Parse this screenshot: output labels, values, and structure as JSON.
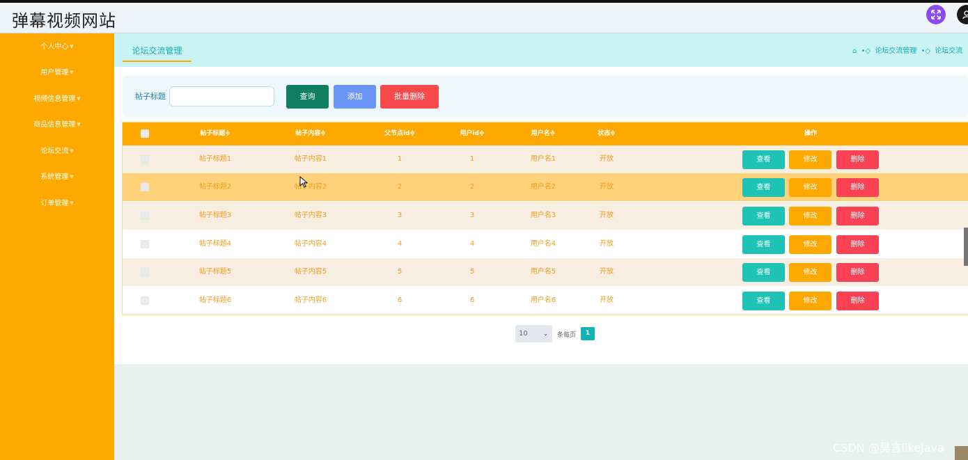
{
  "header": {
    "app_title": "弹幕视频网站",
    "expand_icon": "expand-icon",
    "user_icon": "user-icon"
  },
  "sidebar": {
    "items": [
      {
        "label": "个人中心",
        "icon": "caret-down-icon"
      },
      {
        "label": "用户管理",
        "icon": "caret-down-icon"
      },
      {
        "label": "视频信息管理",
        "icon": "caret-down-icon"
      },
      {
        "label": "商品信息管理",
        "icon": "caret-down-icon"
      },
      {
        "label": "论坛交流",
        "icon": "caret-down-icon"
      },
      {
        "label": "系统管理",
        "icon": "caret-down-icon"
      },
      {
        "label": "订单管理",
        "icon": "caret-down-icon"
      }
    ]
  },
  "tabs": {
    "active_label": "论坛交流管理"
  },
  "breadcrumb": {
    "home_icon": "home-icon",
    "items": [
      "论坛交流管理",
      "论坛交流"
    ]
  },
  "search": {
    "label": "帖子标题",
    "value": "",
    "placeholder": ""
  },
  "actions": {
    "query": "查询",
    "add": "添加",
    "batch_delete": "批量删除"
  },
  "table": {
    "columns": [
      "帖子标题",
      "帖子内容",
      "父节点id",
      "用户id",
      "用户名",
      "状态",
      "操作"
    ],
    "sort_glyph": "≑",
    "rows": [
      {
        "title": "帖子标题1",
        "content": "帖子内容1",
        "parentid": "1",
        "userid": "1",
        "username": "用户名1",
        "status": "开放"
      },
      {
        "title": "帖子标题2",
        "content": "帖子内容2",
        "parentid": "2",
        "userid": "2",
        "username": "用户名2",
        "status": "开放"
      },
      {
        "title": "帖子标题3",
        "content": "帖子内容3",
        "parentid": "3",
        "userid": "3",
        "username": "用户名3",
        "status": "开放"
      },
      {
        "title": "帖子标题4",
        "content": "帖子内容4",
        "parentid": "4",
        "userid": "4",
        "username": "用户名4",
        "status": "开放"
      },
      {
        "title": "帖子标题5",
        "content": "帖子内容5",
        "parentid": "5",
        "userid": "5",
        "username": "用户名5",
        "status": "开放"
      },
      {
        "title": "帖子标题6",
        "content": "帖子内容6",
        "parentid": "6",
        "userid": "6",
        "username": "用户名6",
        "status": "开放"
      }
    ],
    "row_buttons": {
      "view": "查看",
      "edit": "修改",
      "delete": "删除"
    }
  },
  "pagination": {
    "page_size": "10",
    "per_page_label": "条每页",
    "current_page": "1"
  },
  "watermark": "CSDN @昊言likeJava",
  "colors": {
    "sidebar": "#ffa800",
    "accent": "#1aa8a8",
    "view_button": "#1fc3b6",
    "edit_button": "#ffa800",
    "delete_button": "#fa4254",
    "row_alt": "#f8ede1",
    "row_hover": "#ffd27a"
  }
}
